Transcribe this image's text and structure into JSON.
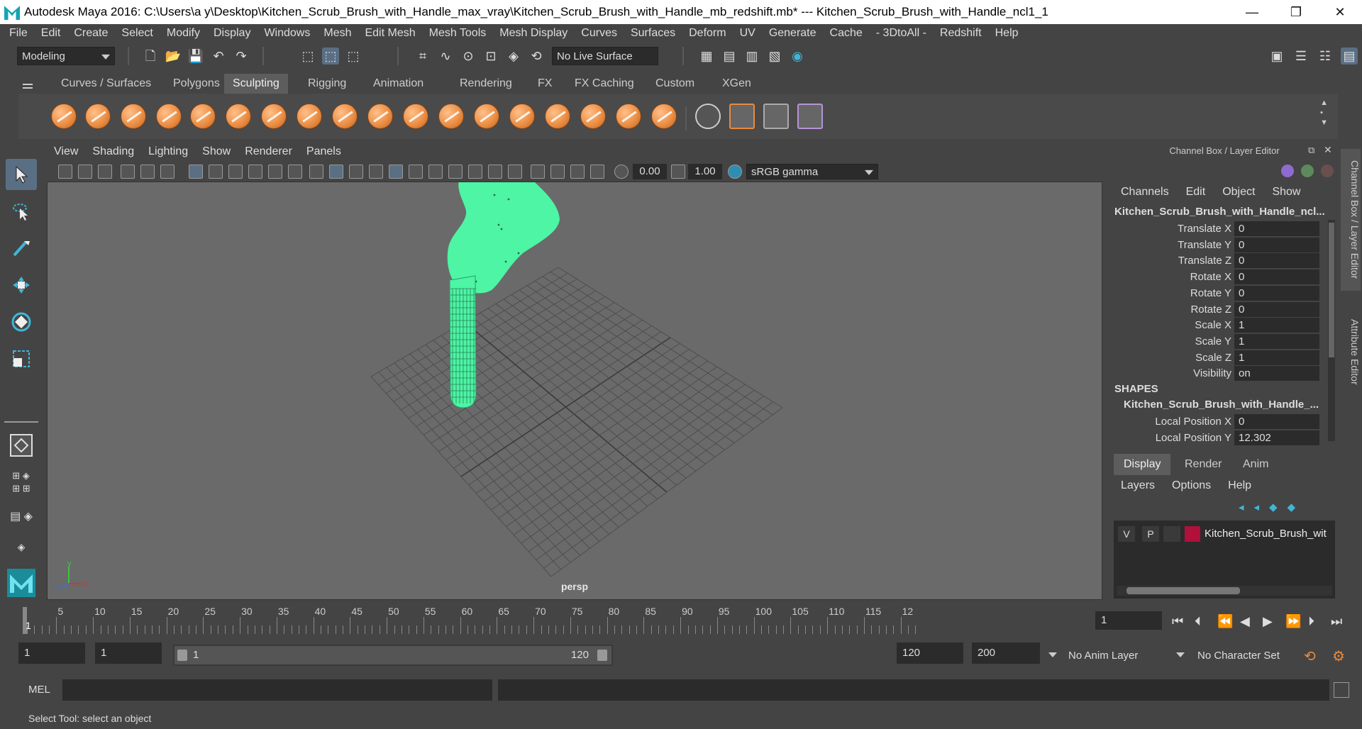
{
  "window": {
    "title": "Autodesk Maya 2016: C:\\Users\\a y\\Desktop\\Kitchen_Scrub_Brush_with_Handle_max_vray\\Kitchen_Scrub_Brush_with_Handle_mb_redshift.mb*   ---   Kitchen_Scrub_Brush_with_Handle_ncl1_1",
    "minimize": "—",
    "maximize": "❐",
    "close": "✕"
  },
  "menubar": [
    "File",
    "Edit",
    "Create",
    "Select",
    "Modify",
    "Display",
    "Windows",
    "Mesh",
    "Edit Mesh",
    "Mesh Tools",
    "Mesh Display",
    "Curves",
    "Surfaces",
    "Deform",
    "UV",
    "Generate",
    "Cache",
    "- 3DtoAll -",
    "Redshift",
    "Help"
  ],
  "statusline": {
    "mode": "Modeling",
    "live_surface": "No Live Surface"
  },
  "shelf": {
    "tabs": [
      "Curves / Surfaces",
      "Polygons",
      "Sculpting",
      "Rigging",
      "Animation",
      "Rendering",
      "FX",
      "FX Caching",
      "Custom",
      "XGen"
    ],
    "active_tab": "Sculpting"
  },
  "viewport": {
    "menu": [
      "View",
      "Shading",
      "Lighting",
      "Show",
      "Renderer",
      "Panels"
    ],
    "exposure": "0.00",
    "gamma": "1.00",
    "color_space": "sRGB gamma",
    "camera_label": "persp",
    "axis_x": "x",
    "axis_y": "y",
    "axis_z": "z",
    "mesh_color": "#4df5a4",
    "background": "#6a6a6a"
  },
  "channelbox": {
    "header": "Channel Box / Layer Editor",
    "menu": [
      "Channels",
      "Edit",
      "Object",
      "Show"
    ],
    "object_name": "Kitchen_Scrub_Brush_with_Handle_ncl...",
    "channels": [
      {
        "label": "Translate X",
        "value": "0"
      },
      {
        "label": "Translate Y",
        "value": "0"
      },
      {
        "label": "Translate Z",
        "value": "0"
      },
      {
        "label": "Rotate X",
        "value": "0"
      },
      {
        "label": "Rotate Y",
        "value": "0"
      },
      {
        "label": "Rotate Z",
        "value": "0"
      },
      {
        "label": "Scale X",
        "value": "1"
      },
      {
        "label": "Scale Y",
        "value": "1"
      },
      {
        "label": "Scale Z",
        "value": "1"
      },
      {
        "label": "Visibility",
        "value": "on"
      }
    ],
    "shapes_header": "SHAPES",
    "shape_name": "Kitchen_Scrub_Brush_with_Handle_...",
    "shape_channels": [
      {
        "label": "Local Position X",
        "value": "0"
      },
      {
        "label": "Local Position Y",
        "value": "12.302"
      }
    ]
  },
  "layer_editor": {
    "tabs": [
      "Display",
      "Render",
      "Anim"
    ],
    "active_tab": "Display",
    "menu": [
      "Layers",
      "Options",
      "Help"
    ],
    "layer": {
      "v": "V",
      "p": "P",
      "name": "Kitchen_Scrub_Brush_wit",
      "color": "#b0103a"
    }
  },
  "side_tabs": [
    "Channel Box / Layer Editor",
    "Attribute Editor"
  ],
  "timeline": {
    "ticks": [
      "5",
      "10",
      "15",
      "20",
      "25",
      "30",
      "35",
      "40",
      "45",
      "50",
      "55",
      "60",
      "65",
      "70",
      "75",
      "80",
      "85",
      "90",
      "95",
      "100",
      "105",
      "110",
      "115",
      "12"
    ],
    "current": "1",
    "current_frame_field": "1"
  },
  "range": {
    "start": "1",
    "playback_start": "1",
    "slider_start": "1",
    "slider_end": "120",
    "playback_end": "120",
    "end": "200",
    "anim_layer": "No Anim Layer",
    "character_set": "No Character Set"
  },
  "mel": {
    "label": "MEL"
  },
  "status": {
    "text": "Select Tool: select an object"
  }
}
